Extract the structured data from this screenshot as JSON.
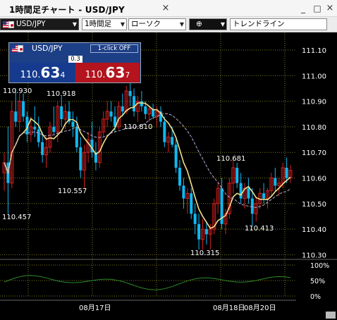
{
  "window": {
    "title": "1時間足チャート - USD/JPY",
    "close_glyph": "×",
    "min_glyph": "_",
    "max_glyph": "□"
  },
  "toolbar": {
    "symbol": "USD/JPY",
    "timeframe": "1時間足",
    "chart_type": "ローソク",
    "crosshair_glyph": "⊕",
    "drawing_tool": "トレンドライン",
    "arrow_glyph": "▼"
  },
  "rate_widget": {
    "symbol": "USD/JPY",
    "one_click": "1-click OFF",
    "spread": "0.3",
    "bid_prefix": "110.",
    "bid_big": "63",
    "bid_pip": "4",
    "ask_prefix": "110.",
    "ask_big": "63",
    "ask_pip": "7"
  },
  "price_axis": {
    "labels": [
      "111.10",
      "111.00",
      "110.90",
      "110.80",
      "110.70",
      "110.60",
      "110.50",
      "110.40",
      "110.30"
    ]
  },
  "annotations": {
    "high1": "110.930",
    "high2": "110.918",
    "low_left": "110.457",
    "low1": "110.557",
    "mid": "110.810",
    "low2": "110.315",
    "high3": "110.681",
    "low3": "110.413"
  },
  "oscillator_axis": {
    "labels": [
      "100%",
      "50%",
      "0%"
    ]
  },
  "time_axis": {
    "labels": [
      "08月17日",
      "08月18日",
      "08月20日"
    ]
  },
  "colors": {
    "up": "#d82020",
    "down": "#10b8f0",
    "ma_fast": "#f2e08c",
    "ma_slow": "#b8a8d0",
    "grid": "#7a7a1e",
    "oscillator": "#2a8a2a"
  }
}
